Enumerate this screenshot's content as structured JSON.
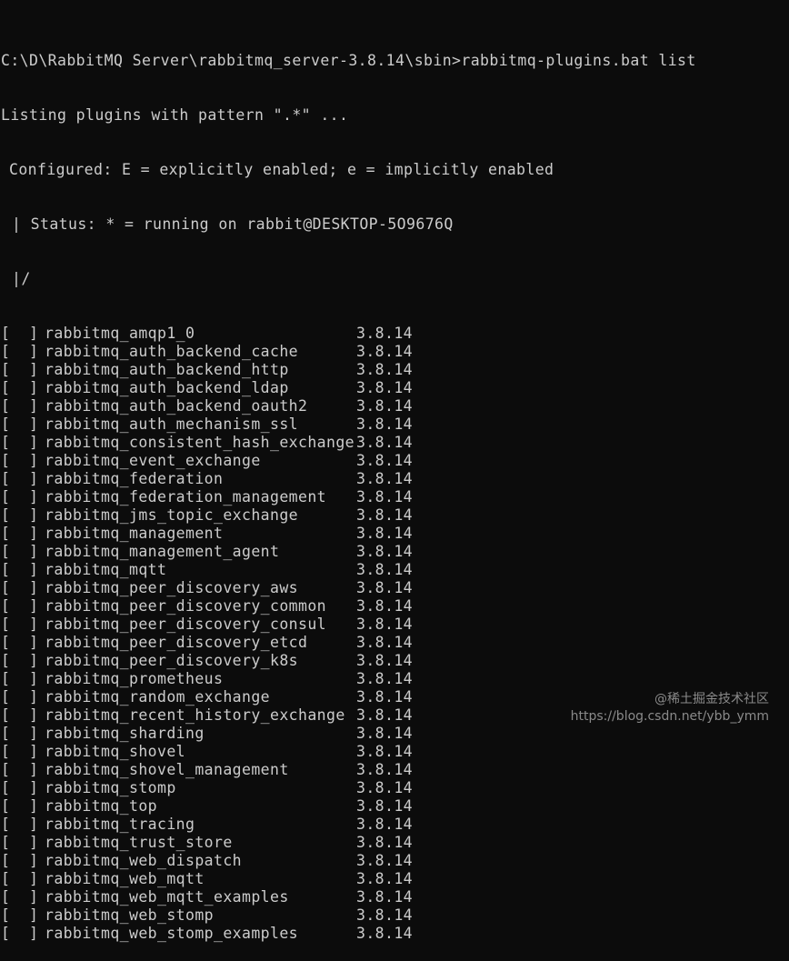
{
  "terminal": {
    "command_line": "C:\\D\\RabbitMQ Server\\rabbitmq_server-3.8.14\\sbin>rabbitmq-plugins.bat list",
    "listing_line": "Listing plugins with pattern \".*\" ...",
    "configured_line": "Configured: E = explicitly enabled; e = implicitly enabled",
    "status_line": "| Status: * = running on rabbit@DESKTOP-5O9676Q",
    "separator_line": "|/"
  },
  "plugins": [
    {
      "checkbox": "[  ]",
      "name": "rabbitmq_amqp1_0",
      "version": "3.8.14"
    },
    {
      "checkbox": "[  ]",
      "name": "rabbitmq_auth_backend_cache",
      "version": "3.8.14"
    },
    {
      "checkbox": "[  ]",
      "name": "rabbitmq_auth_backend_http",
      "version": "3.8.14"
    },
    {
      "checkbox": "[  ]",
      "name": "rabbitmq_auth_backend_ldap",
      "version": "3.8.14"
    },
    {
      "checkbox": "[  ]",
      "name": "rabbitmq_auth_backend_oauth2",
      "version": "3.8.14"
    },
    {
      "checkbox": "[  ]",
      "name": "rabbitmq_auth_mechanism_ssl",
      "version": "3.8.14"
    },
    {
      "checkbox": "[  ]",
      "name": "rabbitmq_consistent_hash_exchange",
      "version": "3.8.14"
    },
    {
      "checkbox": "[  ]",
      "name": "rabbitmq_event_exchange",
      "version": "3.8.14"
    },
    {
      "checkbox": "[  ]",
      "name": "rabbitmq_federation",
      "version": "3.8.14"
    },
    {
      "checkbox": "[  ]",
      "name": "rabbitmq_federation_management",
      "version": "3.8.14"
    },
    {
      "checkbox": "[  ]",
      "name": "rabbitmq_jms_topic_exchange",
      "version": "3.8.14"
    },
    {
      "checkbox": "[  ]",
      "name": "rabbitmq_management",
      "version": "3.8.14"
    },
    {
      "checkbox": "[  ]",
      "name": "rabbitmq_management_agent",
      "version": "3.8.14"
    },
    {
      "checkbox": "[  ]",
      "name": "rabbitmq_mqtt",
      "version": "3.8.14"
    },
    {
      "checkbox": "[  ]",
      "name": "rabbitmq_peer_discovery_aws",
      "version": "3.8.14"
    },
    {
      "checkbox": "[  ]",
      "name": "rabbitmq_peer_discovery_common",
      "version": "3.8.14"
    },
    {
      "checkbox": "[  ]",
      "name": "rabbitmq_peer_discovery_consul",
      "version": "3.8.14"
    },
    {
      "checkbox": "[  ]",
      "name": "rabbitmq_peer_discovery_etcd",
      "version": "3.8.14"
    },
    {
      "checkbox": "[  ]",
      "name": "rabbitmq_peer_discovery_k8s",
      "version": "3.8.14"
    },
    {
      "checkbox": "[  ]",
      "name": "rabbitmq_prometheus",
      "version": "3.8.14"
    },
    {
      "checkbox": "[  ]",
      "name": "rabbitmq_random_exchange",
      "version": "3.8.14"
    },
    {
      "checkbox": "[  ]",
      "name": "rabbitmq_recent_history_exchange",
      "version": "3.8.14"
    },
    {
      "checkbox": "[  ]",
      "name": "rabbitmq_sharding",
      "version": "3.8.14"
    },
    {
      "checkbox": "[  ]",
      "name": "rabbitmq_shovel",
      "version": "3.8.14"
    },
    {
      "checkbox": "[  ]",
      "name": "rabbitmq_shovel_management",
      "version": "3.8.14"
    },
    {
      "checkbox": "[  ]",
      "name": "rabbitmq_stomp",
      "version": "3.8.14"
    },
    {
      "checkbox": "[  ]",
      "name": "rabbitmq_top",
      "version": "3.8.14"
    },
    {
      "checkbox": "[  ]",
      "name": "rabbitmq_tracing",
      "version": "3.8.14"
    },
    {
      "checkbox": "[  ]",
      "name": "rabbitmq_trust_store",
      "version": "3.8.14"
    },
    {
      "checkbox": "[  ]",
      "name": "rabbitmq_web_dispatch",
      "version": "3.8.14"
    },
    {
      "checkbox": "[  ]",
      "name": "rabbitmq_web_mqtt",
      "version": "3.8.14"
    },
    {
      "checkbox": "[  ]",
      "name": "rabbitmq_web_mqtt_examples",
      "version": "3.8.14"
    },
    {
      "checkbox": "[  ]",
      "name": "rabbitmq_web_stomp",
      "version": "3.8.14"
    },
    {
      "checkbox": "[  ]",
      "name": "rabbitmq_web_stomp_examples",
      "version": "3.8.14"
    }
  ],
  "watermark": {
    "line1": "@稀土掘金技术社区",
    "line2": "https://blog.csdn.net/ybb_ymm"
  },
  "colors": {
    "background": "#0c0c0c",
    "text": "#cccccc",
    "watermark": "#8a8a8a"
  }
}
